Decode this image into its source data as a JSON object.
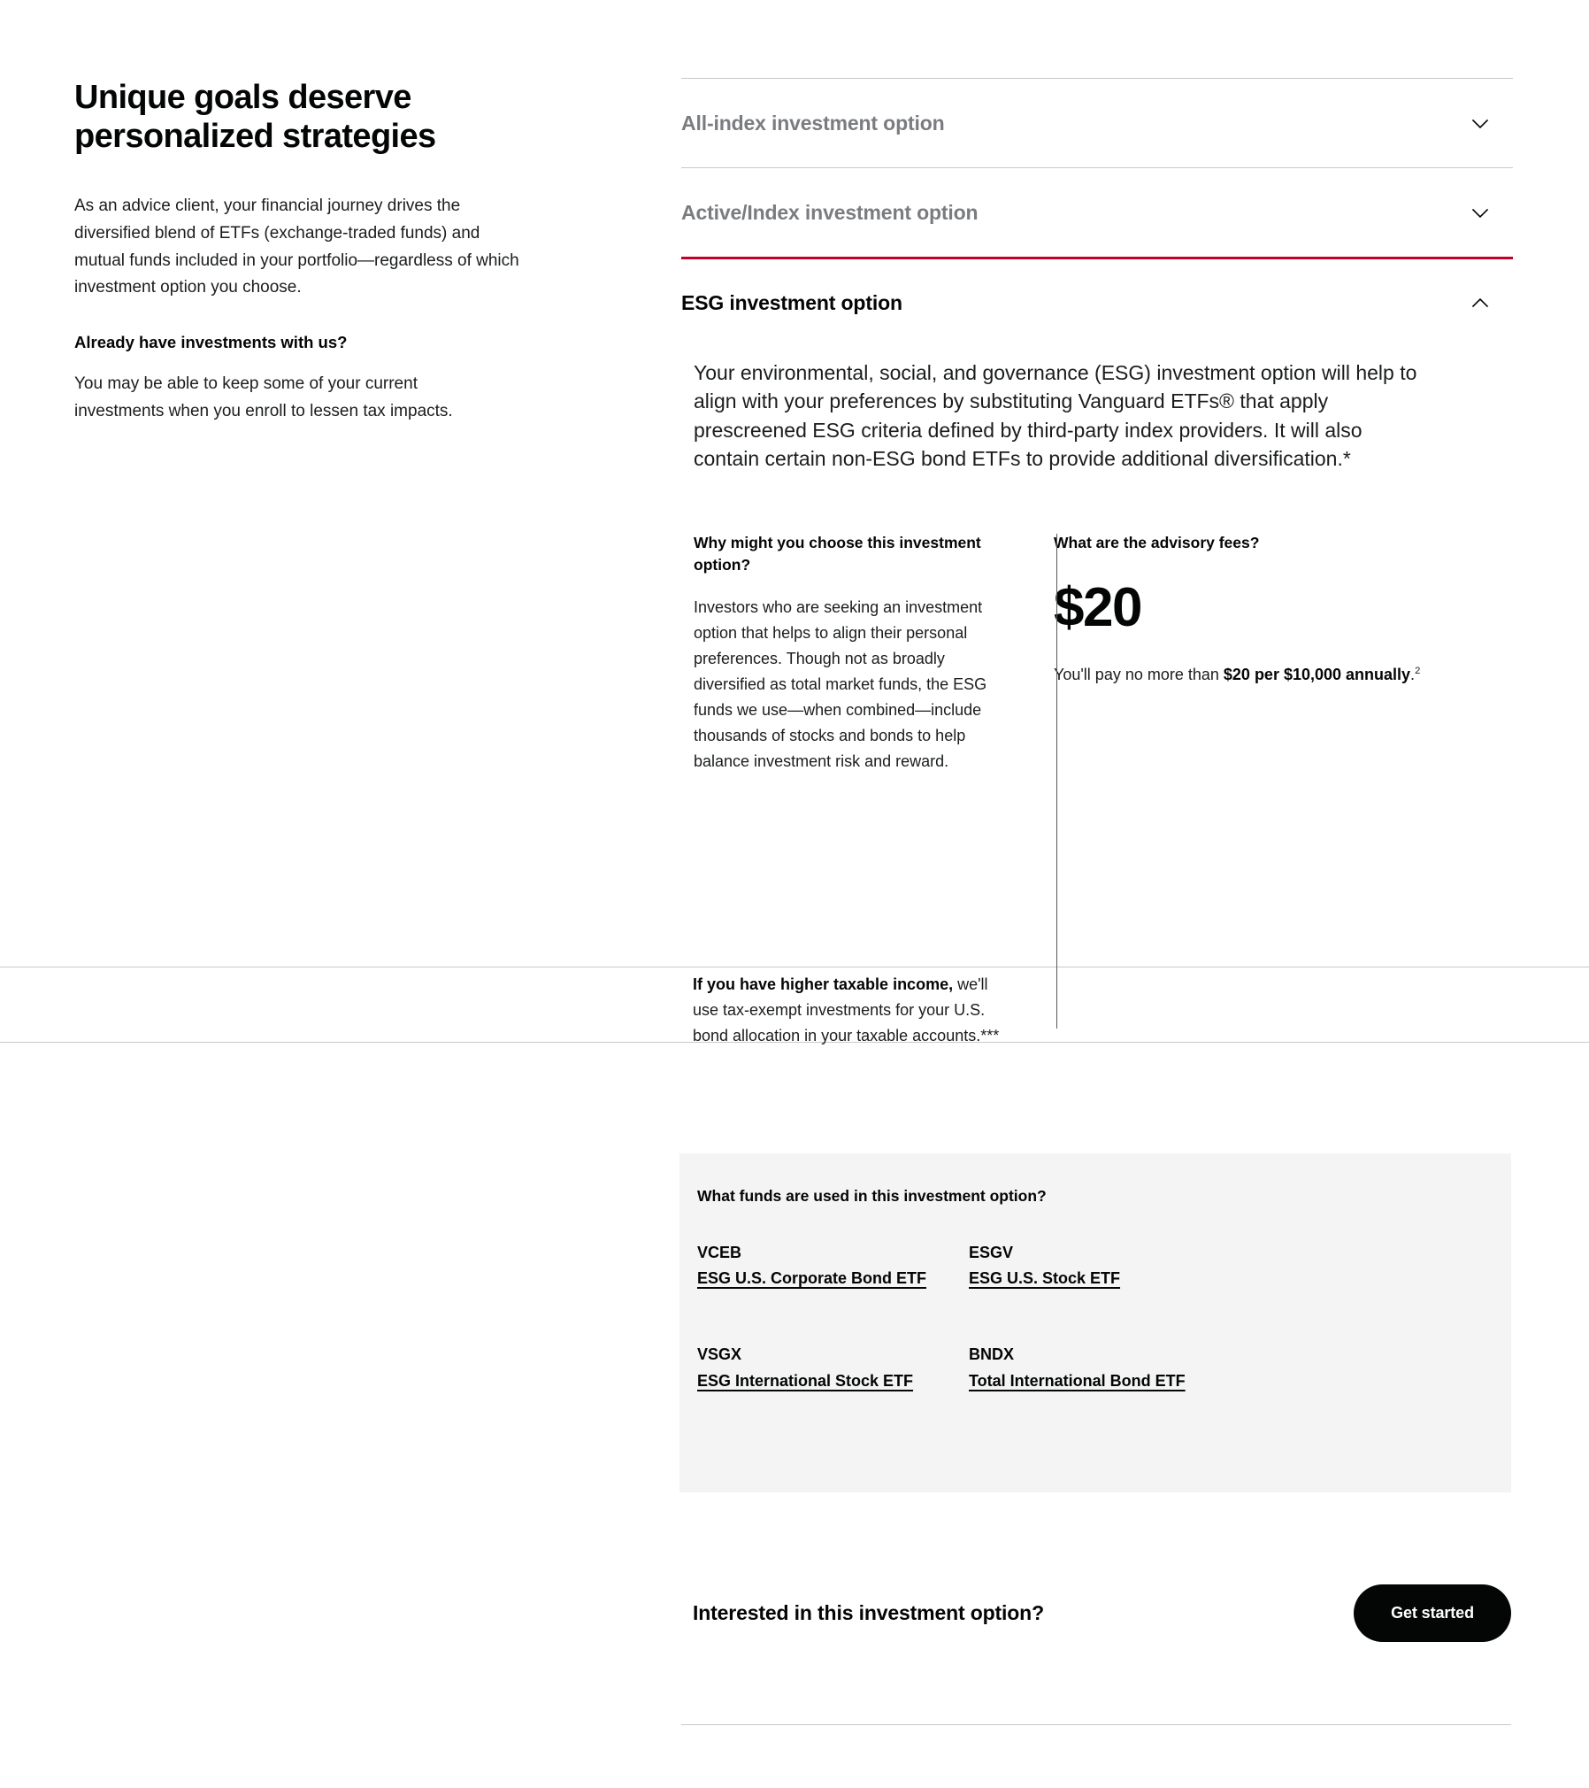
{
  "left": {
    "headline": "Unique goals deserve personalized strategies",
    "lead": "As an advice client, your financial journey drives the diversified blend of ETFs (exchange-traded funds) and mutual funds included in your portfolio—regardless of which investment option you choose.",
    "sub_question": "Already have investments with us?",
    "sub_answer": "You may be able to keep some of your current investments when you enroll to lessen tax impacts."
  },
  "accordion": {
    "items": [
      {
        "title": "All-index investment option",
        "state": "collapsed",
        "icon": "chevron-down-icon"
      },
      {
        "title": "Active/Index investment option",
        "state": "collapsed",
        "icon": "chevron-down-icon"
      },
      {
        "title": "ESG investment option",
        "state": "expanded",
        "icon": "chevron-up-icon"
      }
    ],
    "active_accent_color": "#c20029",
    "divider_color": "#c8c9c7",
    "collapsed_title_color": "#7a7c7f"
  },
  "esg": {
    "body": "Your environmental, social, and governance (ESG) investment option will help to align with your preferences by substituting Vanguard ETFs® that apply prescreened ESG criteria defined by third-party index providers. It will also contain certain non-ESG bond ETFs to provide additional diversification.*",
    "why_heading": "Why might you choose this investment option?",
    "why_body": "Investors who are seeking an investment option that helps to align their personal preferences. Though not as broadly diversified as total market funds, the ESG funds we use—when combined—include thousands of stocks and bonds to help balance investment risk and reward.",
    "fees_heading": "What are the advisory fees?",
    "fee_amount": "$20",
    "fee_note_prefix": "You'll pay no more than ",
    "fee_note_bold": "$20 per $10,000 annually",
    "fee_note_suffix": ".",
    "fee_note_footnote": "2",
    "tax_note_bold": "If you have higher taxable income,",
    "tax_note_rest": " we'll use tax-exempt investments for your U.S. bond allocation in your taxable accounts.***"
  },
  "funds": {
    "heading": "What funds are used in this investment option?",
    "panel_bg": "#f4f4f4",
    "list": [
      {
        "ticker": "VCEB",
        "name": "ESG U.S. Corporate Bond ETF"
      },
      {
        "ticker": "ESGV",
        "name": "ESG U.S. Stock ETF"
      },
      {
        "ticker": "VSGX",
        "name": "ESG International Stock ETF"
      },
      {
        "ticker": "BNDX",
        "name": "Total International Bond ETF"
      }
    ]
  },
  "cta": {
    "text": "Interested in this investment option?",
    "button_label": "Get started",
    "button_bg": "#040505"
  }
}
